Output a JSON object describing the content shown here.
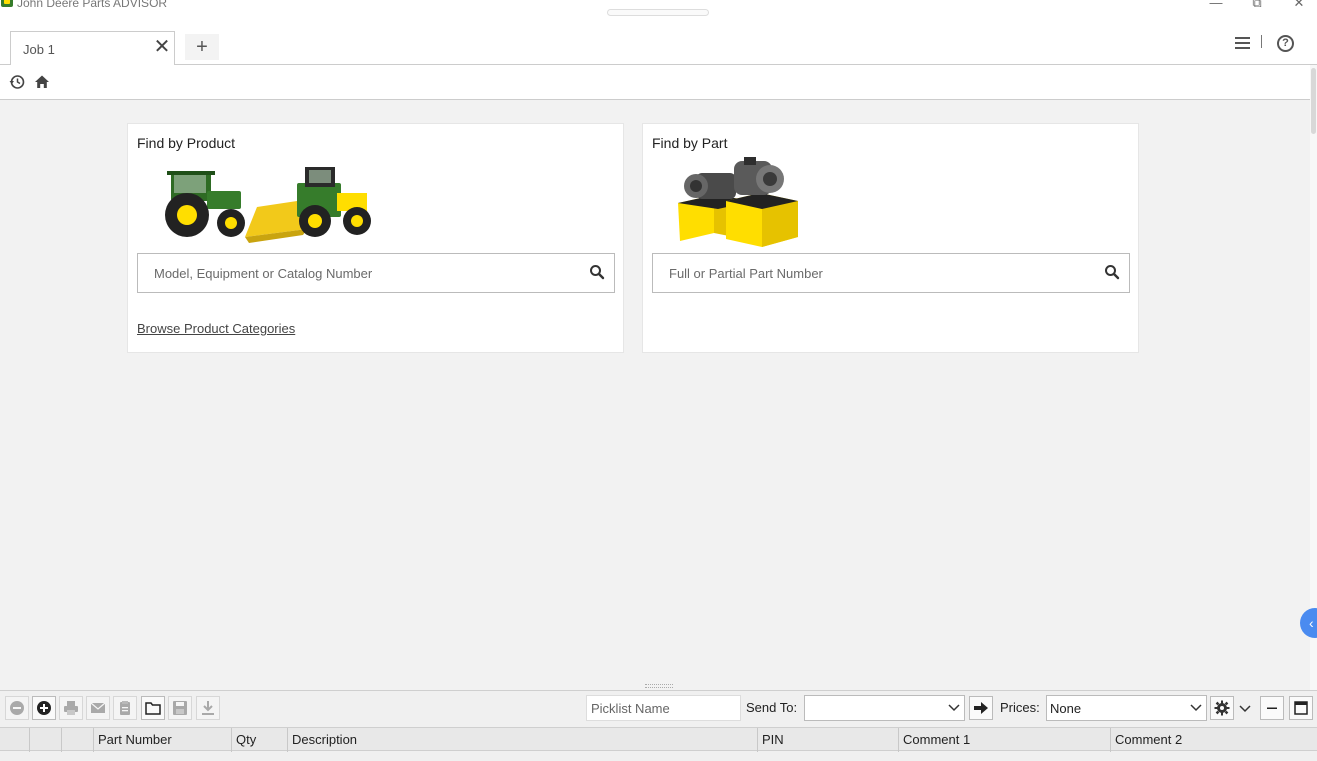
{
  "window": {
    "title": "John Deere Parts ADVISOR",
    "controls": {
      "minimize": "—",
      "restore": "⧉",
      "close": "✕"
    }
  },
  "tabs": [
    {
      "label": "Job 1",
      "close": "✕"
    }
  ],
  "new_tab_label": "+",
  "header": {
    "help": "?"
  },
  "find_by_product": {
    "title": "Find by Product",
    "search_placeholder": "Model, Equipment or Catalog Number",
    "browse_link": "Browse Product Categories"
  },
  "find_by_part": {
    "title": "Find by Part",
    "search_placeholder": "Full or Partial Part Number"
  },
  "side_toggle": "‹",
  "picklist": {
    "name_placeholder": "Picklist Name",
    "send_to_label": "Send To:",
    "send_to_value": "",
    "prices_label": "Prices:",
    "prices_value": "None",
    "columns": [
      "",
      "",
      "",
      "Part Number",
      "Qty",
      "Description",
      "PIN",
      "Comment 1",
      "Comment 2"
    ]
  },
  "colors": {
    "deere_green": "#367c2b",
    "deere_yellow": "#ffde00",
    "accent_blue": "#4a8bf0"
  }
}
